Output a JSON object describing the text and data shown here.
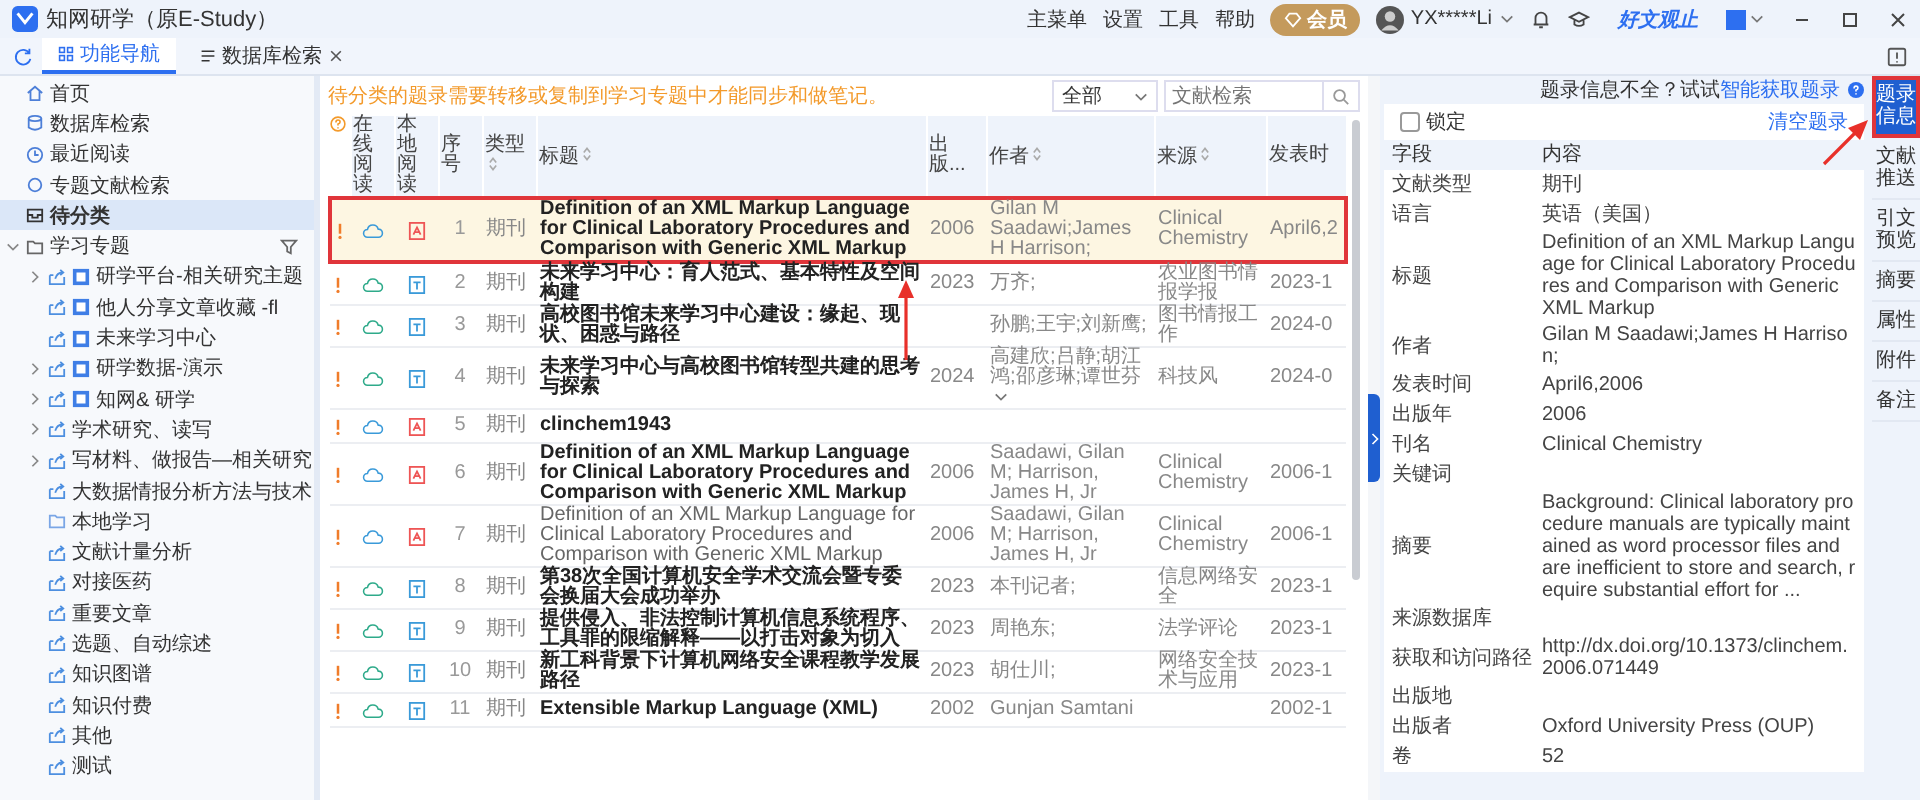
{
  "app": {
    "title": "知网研学（原E-Study）",
    "menu": [
      "主菜单",
      "设置",
      "工具",
      "帮助"
    ],
    "vip_label": "会员",
    "user": "YX*****Li",
    "brand": "好文观止"
  },
  "tabs": [
    {
      "label": "功能导航",
      "selected": true,
      "closable": false
    },
    {
      "label": "数据库检索",
      "selected": false,
      "closable": true
    }
  ],
  "sidebar": {
    "items": [
      {
        "label": "首页",
        "selected": false
      },
      {
        "label": "数据库检索",
        "selected": false
      },
      {
        "label": "最近阅读",
        "selected": false
      },
      {
        "label": "专题文献检索",
        "selected": false
      },
      {
        "label": "待分类",
        "selected": true
      },
      {
        "label": "学习专题",
        "selected": false,
        "expanded": true,
        "children": [
          {
            "label": "研学平台-相关研究主题",
            "kind": "shared",
            "marked": true,
            "expandable": true
          },
          {
            "label": "他人分享文章收藏 -fl",
            "kind": "shared",
            "marked": true,
            "expandable": false
          },
          {
            "label": "未来学习中心",
            "kind": "shared",
            "marked": true,
            "expandable": false
          },
          {
            "label": "研学数据-演示",
            "kind": "shared",
            "marked": true,
            "expandable": true
          },
          {
            "label": "知网& 研学",
            "kind": "shared",
            "marked": true,
            "expandable": true
          },
          {
            "label": "学术研究、读写",
            "kind": "shared",
            "marked": false,
            "expandable": true
          },
          {
            "label": "写材料、做报告—相关研究",
            "kind": "shared",
            "marked": false,
            "expandable": true
          },
          {
            "label": "大数据情报分析方法与技术",
            "kind": "shared",
            "marked": false,
            "expandable": false
          },
          {
            "label": "本地学习",
            "kind": "local",
            "marked": false,
            "expandable": false
          },
          {
            "label": "文献计量分析",
            "kind": "shared",
            "marked": false,
            "expandable": false
          },
          {
            "label": "对接医药",
            "kind": "shared",
            "marked": false,
            "expandable": false
          },
          {
            "label": "重要文章",
            "kind": "shared",
            "marked": false,
            "expandable": false
          },
          {
            "label": "选题、自动综述",
            "kind": "shared",
            "marked": false,
            "expandable": false
          },
          {
            "label": "知识图谱",
            "kind": "shared",
            "marked": false,
            "expandable": false
          },
          {
            "label": "知识付费",
            "kind": "shared",
            "marked": false,
            "expandable": false
          },
          {
            "label": "其他",
            "kind": "shared",
            "marked": false,
            "expandable": false
          },
          {
            "label": "测试",
            "kind": "shared",
            "marked": false,
            "expandable": false
          }
        ]
      }
    ]
  },
  "notice": "待分类的题录需要转移或复制到学习专题中才能同步和做笔记。",
  "filter": {
    "value": "全部"
  },
  "search": {
    "placeholder": "文献检索"
  },
  "table": {
    "columns": [
      {
        "label": "在线阅读",
        "sortable": false
      },
      {
        "label": "本地阅读",
        "sortable": false
      },
      {
        "label": "序号",
        "sortable": false
      },
      {
        "label": "类型",
        "sortable": true
      },
      {
        "label": "标题",
        "sortable": true
      },
      {
        "label": "出版...",
        "sortable": false
      },
      {
        "label": "作者",
        "sortable": true
      },
      {
        "label": "来源",
        "sortable": true
      },
      {
        "label": "发表时",
        "sortable": false
      }
    ],
    "rows": [
      {
        "kind": "pdf",
        "index": "1",
        "type": "期刊",
        "title": "Definition of an XML Markup Language for Clinical Laboratory Procedures and Comparison with Generic XML Markup",
        "bold": true,
        "year": "2006",
        "author": "Gilan M Saadawi;James H Harrison;",
        "source": "Clinical Chemistry",
        "date": "April6,2",
        "selected": true
      },
      {
        "kind": "doc",
        "index": "2",
        "type": "期刊",
        "title": "未来学习中心：育人范式、基本特性及空间构建",
        "bold": true,
        "year": "2023",
        "author": "万齐;",
        "source": "农业图书情报学报",
        "date": "2023-1",
        "selected": false
      },
      {
        "kind": "doc",
        "index": "3",
        "type": "期刊",
        "title": "高校图书馆未来学习中心建设：缘起、现状、困惑与路径",
        "bold": true,
        "author": "孙鹏;王宇;刘新鹰;",
        "source": "图书情报工作",
        "date": "2024-0",
        "selected": false
      },
      {
        "kind": "doc",
        "index": "4",
        "type": "期刊",
        "title": "未来学习中心与高校图书馆转型共建的思考与探索",
        "bold": true,
        "year": "2024",
        "author": "高建欣;吕静;胡江鸿;邵彦琳;谭世芬",
        "more_authors": true,
        "source": "科技风",
        "date": "2024-0",
        "selected": false
      },
      {
        "kind": "pdf",
        "index": "5",
        "type": "期刊",
        "title": "clinchem1943",
        "bold": true,
        "selected": false
      },
      {
        "kind": "pdf",
        "index": "6",
        "type": "期刊",
        "title": "Definition of an XML Markup Language for Clinical Laboratory Procedures and Comparison with Generic XML Markup",
        "bold": true,
        "year": "2006",
        "author": "Saadawi, Gilan M; Harrison, James H, Jr",
        "source": "Clinical Chemistry",
        "date": "2006-1",
        "selected": false
      },
      {
        "kind": "pdf",
        "index": "7",
        "type": "期刊",
        "title": "Definition of an XML Markup Language for Clinical Laboratory Procedures and Comparison with Generic XML Markup",
        "bold": false,
        "year": "2006",
        "author": "Saadawi, Gilan M; Harrison, James H, Jr",
        "source": "Clinical Chemistry",
        "date": "2006-1",
        "selected": false
      },
      {
        "kind": "doc",
        "index": "8",
        "type": "期刊",
        "title": "第38次全国计算机安全学术交流会暨专委会换届大会成功举办",
        "bold": true,
        "year": "2023",
        "author": "本刊记者;",
        "source": "信息网络安全",
        "date": "2023-1",
        "selected": false
      },
      {
        "kind": "doc",
        "index": "9",
        "type": "期刊",
        "title": "提供侵入、非法控制计算机信息系统程序、工具罪的限缩解释——以打击对象为切入",
        "bold": true,
        "year": "2023",
        "author": "周艳东;",
        "source": "法学评论",
        "date": "2023-1",
        "selected": false
      },
      {
        "kind": "doc",
        "index": "10",
        "type": "期刊",
        "title": "新工科背景下计算机网络安全课程教学发展路径",
        "bold": true,
        "year": "2023",
        "author": "胡仕川;",
        "source": "网络安全技术与应用",
        "date": "2023-1",
        "selected": false
      },
      {
        "kind": "doc",
        "index": "11",
        "type": "期刊",
        "title": "Extensible Markup Language (XML)",
        "bold": true,
        "year": "2002",
        "author": "Gunjan Samtani",
        "date": "2002-1",
        "selected": false
      }
    ]
  },
  "details": {
    "hint": "题录信息不全？试试",
    "hint_link": "智能获取题录",
    "lock": {
      "label": "锁定",
      "checked": false
    },
    "clear": "清空题录",
    "header": {
      "field": "字段",
      "content": "内容"
    },
    "fields": [
      {
        "name": "文献类型",
        "value": "期刊"
      },
      {
        "name": "语言",
        "value": "英语（美国）"
      },
      {
        "name": "标题",
        "value": "Definition of an XML Markup Language for Clinical Laboratory Procedures and Comparison with Generic XML Markup"
      },
      {
        "name": "作者",
        "value": "Gilan M Saadawi;James H Harrison;"
      },
      {
        "name": "发表时间",
        "value": "April6,2006"
      },
      {
        "name": "出版年",
        "value": "2006"
      },
      {
        "name": "刊名",
        "value": "Clinical Chemistry"
      },
      {
        "name": "关键词"
      },
      {
        "name": "摘要",
        "value": "Background: Clinical laboratory procedure manuals are typically maintained as word processor files and are inefficient to store and search, require substantial effort for ..."
      },
      {
        "name": "来源数据库"
      },
      {
        "name": "获取和访问路径",
        "value": "http://dx.doi.org/10.1373/clinchem.2006.071449"
      },
      {
        "name": "出版地"
      },
      {
        "name": "出版者",
        "value": "Oxford University Press (OUP)"
      },
      {
        "name": "卷",
        "value": "52"
      }
    ]
  },
  "side_tabs": [
    {
      "label": "题录信息",
      "selected": true
    },
    {
      "label": "文献推送",
      "selected": false
    },
    {
      "label": "引文预览",
      "selected": false
    },
    {
      "label": "摘要",
      "selected": false
    },
    {
      "label": "属性",
      "selected": false
    },
    {
      "label": "附件",
      "selected": false
    },
    {
      "label": "备注",
      "selected": false
    }
  ]
}
